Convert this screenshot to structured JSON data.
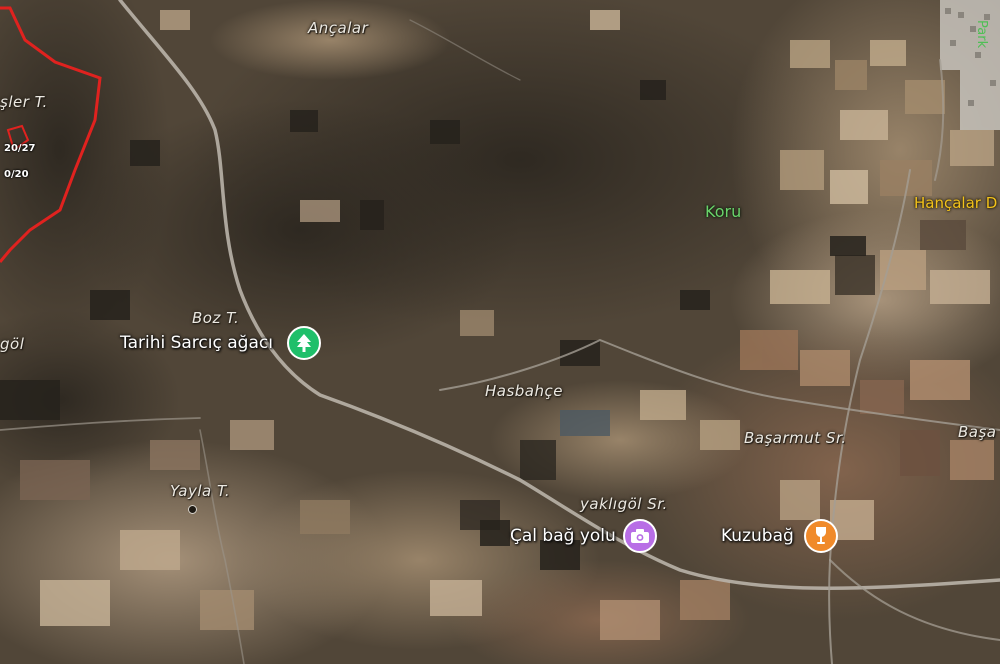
{
  "map": {
    "places": {
      "ancalar": "Ançalar",
      "boz_t": "Boz T.",
      "hasbahce": "Hasbahçe",
      "basarmut_sr": "Başarmut Sr.",
      "basa": "Başa",
      "yayla_t": "Yayla T.",
      "yakligol_sr": "yaklıgöl Sr.",
      "sler_t": "şler T.",
      "gol": "göl"
    },
    "green_labels": {
      "koru": "Koru",
      "park_edge": "Park"
    },
    "yellow_labels": {
      "hancalar": "Hançalar D"
    },
    "red_labels": {
      "r1": "20/27",
      "r2": "0/20"
    },
    "pois": [
      {
        "label": "Tarihi Sarcıç ağacı",
        "icon": "tree-icon",
        "color": "#1fbf6a"
      },
      {
        "label": "Çal bağ yolu",
        "icon": "camera-icon",
        "color": "#b86ee6"
      },
      {
        "label": "Kuzubağ",
        "icon": "wine-glass-icon",
        "color": "#f08a2a"
      }
    ],
    "colors": {
      "boundary": "#e0221f",
      "road": "#a9a29a",
      "forest": "#2f2a22",
      "field_light": "#b59e80"
    }
  }
}
